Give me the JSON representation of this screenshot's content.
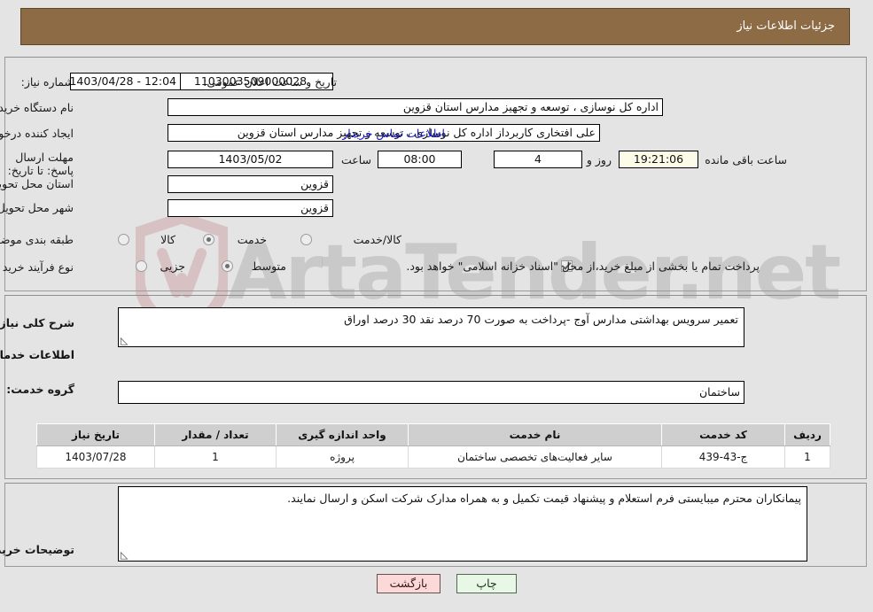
{
  "header": {
    "title": "جزئیات اطلاعات نیاز",
    "bar_color": "#8d6b45"
  },
  "watermark": {
    "text": "ArtaTender.net"
  },
  "top_form": {
    "need_number_label": "شماره نیاز:",
    "need_number_value": "1103003509000028",
    "public_announce_label": "تاریخ و ساعت اعلان عمومی:",
    "public_announce_value": "12:04 - 1403/04/28",
    "buyer_org_label": "نام دستگاه خریدار:",
    "buyer_org_value": "اداره کل نوسازی ، توسعه و تجهیز مدارس استان قزوین",
    "requester_label": "ایجاد کننده درخواست:",
    "requester_value": "علی افتخاری کاربرداز اداره کل نوسازی ، توسعه و تجهیز مدارس استان قزوین",
    "buyer_contact_link": "اطلاعات تماس خریدار",
    "deadline_label": "مهلت ارسال پاسخ: تا تاریخ:",
    "deadline_date": "1403/05/02",
    "deadline_time_label": "ساعت",
    "deadline_time": "08:00",
    "days_remaining": "4",
    "days_unit_label": "روز و",
    "time_remaining": "19:21:06",
    "time_remaining_suffix": "ساعت باقی مانده",
    "province_label": "استان محل تحویل:",
    "province_value": "قزوین",
    "city_label": "شهر محل تحویل:",
    "city_value": "قزوین",
    "category_label": "طبقه بندی موضوعی:",
    "category_options": [
      {
        "label": "کالا",
        "selected": false
      },
      {
        "label": "خدمت",
        "selected": true
      },
      {
        "label": "کالا/خدمت",
        "selected": false
      }
    ],
    "process_label": "نوع فرآیند خرید :",
    "process_options": [
      {
        "label": "جزیی",
        "selected": false
      },
      {
        "label": "متوسط",
        "selected": true
      }
    ],
    "treasury_checkbox_checked": true,
    "treasury_note": "پرداخت تمام یا بخشی از مبلغ خرید،از محل \"اسناد خزانه اسلامی\" خواهد بود."
  },
  "middle": {
    "general_desc_label": "شرح کلی نیاز:",
    "general_desc_value": "تعمیر سرویس بهداشتی مدارس  آوج -پرداخت به صورت 70 درصد نقد 30 درصد اوراق",
    "services_section_title": "اطلاعات خدمات مورد نیاز",
    "service_group_label": "گروه خدمت:",
    "service_group_value": "ساختمان",
    "table": {
      "columns": [
        "ردیف",
        "کد خدمت",
        "نام خدمت",
        "واحد اندازه گیری",
        "تعداد / مقدار",
        "تاریخ نیاز"
      ],
      "rows": [
        [
          "1",
          "ج-43-439",
          "سایر فعالیت‌های تخصصی ساختمان",
          "پروژه",
          "1",
          "1403/07/28"
        ]
      ]
    }
  },
  "bottom": {
    "buyer_notes_label": "توضیحات خریدار:",
    "buyer_notes_value": "پیمانکاران محترم میبایستی فرم استعلام و پیشنهاد قیمت تکمیل و به همراه مدارک شرکت اسکن و ارسال نمایند."
  },
  "footer": {
    "print_label": "چاپ",
    "back_label": "بازگشت"
  }
}
